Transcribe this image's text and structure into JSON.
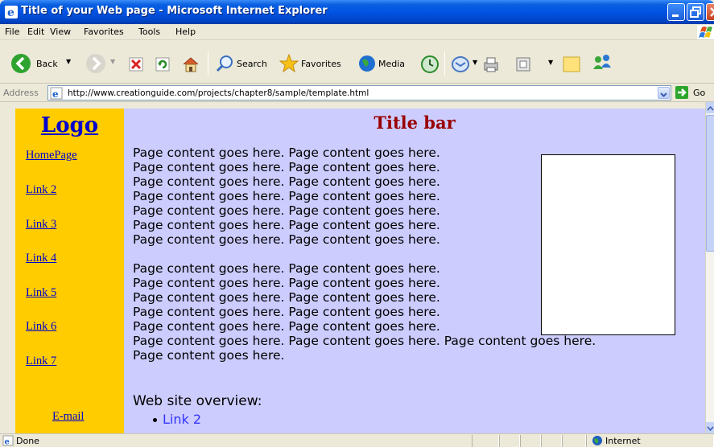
{
  "window": {
    "title": "Title of your Web page - Microsoft Internet Explorer"
  },
  "menu": [
    "File",
    "Edit",
    "View",
    "Favorites",
    "Tools",
    "Help"
  ],
  "toolbar": {
    "back_label": "Back",
    "search_label": "Search",
    "favorites_label": "Favorites",
    "media_label": "Media"
  },
  "address": {
    "label": "Address",
    "url": "http://www.creationguide.com/projects/chapter8/sample/template.html",
    "go_label": "Go"
  },
  "page": {
    "logo": "Logo",
    "title_bar": "Title bar",
    "nav_links": [
      "HomePage",
      "Link 2",
      "Link 3",
      "Link 4",
      "Link 5",
      "Link 6",
      "Link 7"
    ],
    "email_link": "E-mail",
    "paragraph1_lines": [
      "Page content goes here. Page content goes here.",
      "Page content goes here. Page content goes here.",
      "Page content goes here. Page content goes here.",
      "Page content goes here. Page content goes here.",
      "Page content goes here. Page content goes here.",
      "Page content goes here. Page content goes here.",
      "Page content goes here. Page content goes here."
    ],
    "paragraph2_lines": [
      "Page content goes here. Page content goes here.",
      "Page content goes here. Page content goes here.",
      "Page content goes here. Page content goes here.",
      "Page content goes here. Page content goes here.",
      "Page content goes here. Page content goes here.",
      "Page content goes here. Page content goes here. Page content goes here.",
      "Page content goes here."
    ],
    "overview_title": "Web site overview:",
    "overview_links": [
      "Link 2"
    ]
  },
  "status": {
    "text": "Done",
    "zone": "Internet"
  }
}
